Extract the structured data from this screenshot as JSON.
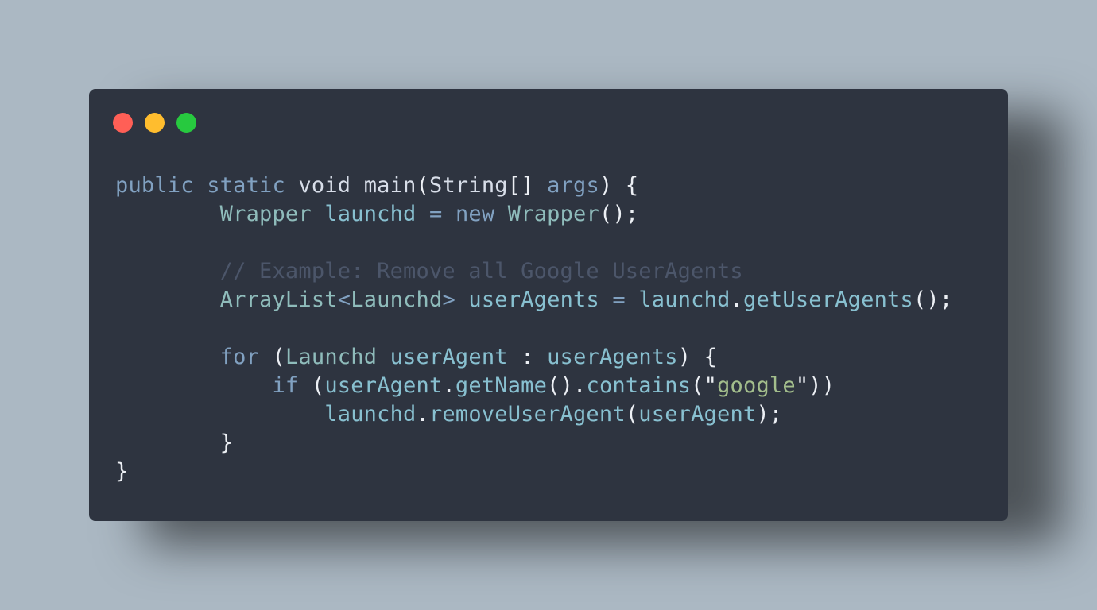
{
  "window": {
    "controls": [
      {
        "name": "close",
        "color": "#ff5f56"
      },
      {
        "name": "minimize",
        "color": "#ffbd2e"
      },
      {
        "name": "maximize",
        "color": "#27c93f"
      }
    ]
  },
  "code": {
    "language": "java",
    "lines": [
      {
        "tokens": [
          {
            "t": "public",
            "k": "kw"
          },
          {
            "t": " ",
            "k": "plain"
          },
          {
            "t": "static",
            "k": "kw"
          },
          {
            "t": " ",
            "k": "plain"
          },
          {
            "t": "void",
            "k": "plain"
          },
          {
            "t": " ",
            "k": "plain"
          },
          {
            "t": "main",
            "k": "plain"
          },
          {
            "t": "(",
            "k": "punct"
          },
          {
            "t": "String",
            "k": "plain"
          },
          {
            "t": "[]",
            "k": "punct"
          },
          {
            "t": " ",
            "k": "plain"
          },
          {
            "t": "args",
            "k": "kw"
          },
          {
            "t": ")",
            "k": "punct"
          },
          {
            "t": " {",
            "k": "punct"
          }
        ]
      },
      {
        "tokens": [
          {
            "t": "        ",
            "k": "plain"
          },
          {
            "t": "Wrapper",
            "k": "type"
          },
          {
            "t": " ",
            "k": "plain"
          },
          {
            "t": "launchd",
            "k": "ident"
          },
          {
            "t": " ",
            "k": "plain"
          },
          {
            "t": "=",
            "k": "kw"
          },
          {
            "t": " ",
            "k": "plain"
          },
          {
            "t": "new",
            "k": "kw"
          },
          {
            "t": " ",
            "k": "plain"
          },
          {
            "t": "Wrapper",
            "k": "type"
          },
          {
            "t": "();",
            "k": "punct"
          }
        ]
      },
      {
        "tokens": []
      },
      {
        "tokens": [
          {
            "t": "        ",
            "k": "plain"
          },
          {
            "t": "// Example: Remove all Google UserAgents",
            "k": "cmt"
          }
        ]
      },
      {
        "tokens": [
          {
            "t": "        ",
            "k": "plain"
          },
          {
            "t": "ArrayList",
            "k": "type"
          },
          {
            "t": "<",
            "k": "kw"
          },
          {
            "t": "Launchd",
            "k": "type"
          },
          {
            "t": ">",
            "k": "kw"
          },
          {
            "t": " ",
            "k": "plain"
          },
          {
            "t": "userAgents",
            "k": "ident"
          },
          {
            "t": " ",
            "k": "plain"
          },
          {
            "t": "=",
            "k": "kw"
          },
          {
            "t": " ",
            "k": "plain"
          },
          {
            "t": "launchd",
            "k": "ident"
          },
          {
            "t": ".",
            "k": "punct"
          },
          {
            "t": "getUserAgents",
            "k": "ident"
          },
          {
            "t": "();",
            "k": "punct"
          }
        ]
      },
      {
        "tokens": []
      },
      {
        "tokens": [
          {
            "t": "        ",
            "k": "plain"
          },
          {
            "t": "for",
            "k": "kw"
          },
          {
            "t": " ",
            "k": "plain"
          },
          {
            "t": "(",
            "k": "punct"
          },
          {
            "t": "Launchd",
            "k": "type"
          },
          {
            "t": " ",
            "k": "plain"
          },
          {
            "t": "userAgent",
            "k": "ident"
          },
          {
            "t": " ",
            "k": "plain"
          },
          {
            "t": ":",
            "k": "punct"
          },
          {
            "t": " ",
            "k": "plain"
          },
          {
            "t": "userAgents",
            "k": "ident"
          },
          {
            "t": ")",
            "k": "punct"
          },
          {
            "t": " {",
            "k": "punct"
          }
        ]
      },
      {
        "tokens": [
          {
            "t": "            ",
            "k": "plain"
          },
          {
            "t": "if",
            "k": "kw"
          },
          {
            "t": " ",
            "k": "plain"
          },
          {
            "t": "(",
            "k": "punct"
          },
          {
            "t": "userAgent",
            "k": "ident"
          },
          {
            "t": ".",
            "k": "punct"
          },
          {
            "t": "getName",
            "k": "ident"
          },
          {
            "t": "().",
            "k": "punct"
          },
          {
            "t": "contains",
            "k": "ident"
          },
          {
            "t": "(",
            "k": "punct"
          },
          {
            "t": "\"",
            "k": "punct"
          },
          {
            "t": "google",
            "k": "str"
          },
          {
            "t": "\"",
            "k": "punct"
          },
          {
            "t": "))",
            "k": "punct"
          }
        ]
      },
      {
        "tokens": [
          {
            "t": "                ",
            "k": "plain"
          },
          {
            "t": "launchd",
            "k": "ident"
          },
          {
            "t": ".",
            "k": "punct"
          },
          {
            "t": "removeUserAgent",
            "k": "ident"
          },
          {
            "t": "(",
            "k": "punct"
          },
          {
            "t": "userAgent",
            "k": "ident"
          },
          {
            "t": ");",
            "k": "punct"
          }
        ]
      },
      {
        "tokens": [
          {
            "t": "        ",
            "k": "plain"
          },
          {
            "t": "}",
            "k": "punct"
          }
        ]
      },
      {
        "tokens": [
          {
            "t": "}",
            "k": "punct"
          }
        ]
      }
    ]
  }
}
